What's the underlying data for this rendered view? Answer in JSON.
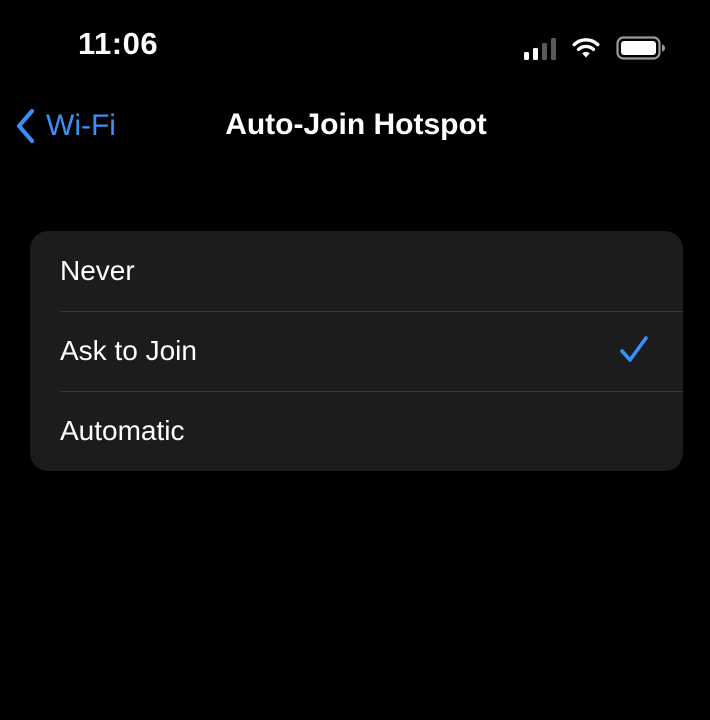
{
  "status_bar": {
    "time": "11:06",
    "signal_bars_active": 2,
    "signal_bars_total": 4
  },
  "nav": {
    "back_label": "Wi-Fi",
    "title": "Auto-Join Hotspot"
  },
  "options": [
    {
      "label": "Never",
      "selected": false
    },
    {
      "label": "Ask to Join",
      "selected": true
    },
    {
      "label": "Automatic",
      "selected": false
    }
  ],
  "colors": {
    "accent": "#3b8ff5",
    "background": "#000000",
    "card": "#1c1c1e",
    "separator": "#38383a"
  }
}
